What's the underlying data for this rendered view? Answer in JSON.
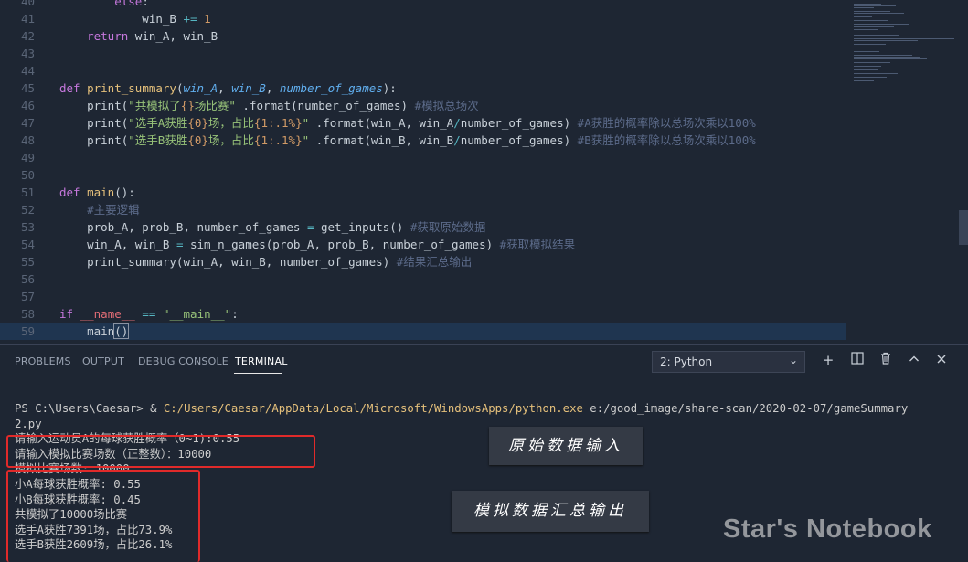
{
  "editor": {
    "lines": [
      {
        "n": "40",
        "segs": [
          {
            "t": "        ",
            "c": ""
          },
          {
            "t": "else",
            "c": "kw"
          },
          {
            "t": ":",
            "c": ""
          }
        ]
      },
      {
        "n": "41",
        "segs": [
          {
            "t": "            win_B ",
            "c": ""
          },
          {
            "t": "+=",
            "c": "op"
          },
          {
            "t": " ",
            "c": ""
          },
          {
            "t": "1",
            "c": "num"
          }
        ]
      },
      {
        "n": "42",
        "segs": [
          {
            "t": "    ",
            "c": ""
          },
          {
            "t": "return",
            "c": "kw"
          },
          {
            "t": " win_A, win_B",
            "c": ""
          }
        ]
      },
      {
        "n": "43",
        "segs": []
      },
      {
        "n": "44",
        "segs": []
      },
      {
        "n": "45",
        "segs": [
          {
            "t": "def",
            "c": "kw"
          },
          {
            "t": " ",
            "c": ""
          },
          {
            "t": "print_summary",
            "c": "fn"
          },
          {
            "t": "(",
            "c": ""
          },
          {
            "t": "win_A",
            "c": "pm"
          },
          {
            "t": ", ",
            "c": ""
          },
          {
            "t": "win_B",
            "c": "pm"
          },
          {
            "t": ", ",
            "c": ""
          },
          {
            "t": "number_of_games",
            "c": "pm"
          },
          {
            "t": "):",
            "c": ""
          }
        ]
      },
      {
        "n": "46",
        "segs": [
          {
            "t": "    print(",
            "c": ""
          },
          {
            "t": "\"共模拟了",
            "c": "st"
          },
          {
            "t": "{}",
            "c": "brace"
          },
          {
            "t": "场比赛\"",
            "c": "st"
          },
          {
            "t": " .format(number_of_games)",
            "c": ""
          },
          {
            "t": " #模拟总场次",
            "c": "cm"
          }
        ]
      },
      {
        "n": "47",
        "segs": [
          {
            "t": "    print(",
            "c": ""
          },
          {
            "t": "\"选手A获胜",
            "c": "st"
          },
          {
            "t": "{0}",
            "c": "brace"
          },
          {
            "t": "场，占比",
            "c": "st"
          },
          {
            "t": "{1:.1%}",
            "c": "brace"
          },
          {
            "t": "\"",
            "c": "st"
          },
          {
            "t": " .format(win_A, win_A",
            "c": ""
          },
          {
            "t": "/",
            "c": "op"
          },
          {
            "t": "number_of_games)",
            "c": ""
          },
          {
            "t": " #A获胜的概率除以总场次乘以100%",
            "c": "cm"
          }
        ]
      },
      {
        "n": "48",
        "segs": [
          {
            "t": "    print(",
            "c": ""
          },
          {
            "t": "\"选手B获胜",
            "c": "st"
          },
          {
            "t": "{0}",
            "c": "brace"
          },
          {
            "t": "场，占比",
            "c": "st"
          },
          {
            "t": "{1:.1%}",
            "c": "brace"
          },
          {
            "t": "\"",
            "c": "st"
          },
          {
            "t": " .format(win_B, win_B",
            "c": ""
          },
          {
            "t": "/",
            "c": "op"
          },
          {
            "t": "number_of_games)",
            "c": ""
          },
          {
            "t": " #B获胜的概率除以总场次乘以100%",
            "c": "cm"
          }
        ]
      },
      {
        "n": "49",
        "segs": []
      },
      {
        "n": "50",
        "segs": []
      },
      {
        "n": "51",
        "segs": [
          {
            "t": "def",
            "c": "kw"
          },
          {
            "t": " ",
            "c": ""
          },
          {
            "t": "main",
            "c": "fn"
          },
          {
            "t": "():",
            "c": ""
          }
        ]
      },
      {
        "n": "52",
        "segs": [
          {
            "t": "    ",
            "c": ""
          },
          {
            "t": "#主要逻辑",
            "c": "cm"
          }
        ]
      },
      {
        "n": "53",
        "segs": [
          {
            "t": "    prob_A, prob_B, number_of_games ",
            "c": ""
          },
          {
            "t": "=",
            "c": "op"
          },
          {
            "t": " get_inputs()",
            "c": ""
          },
          {
            "t": " #获取原始数据",
            "c": "cm"
          }
        ]
      },
      {
        "n": "54",
        "segs": [
          {
            "t": "    win_A, win_B ",
            "c": ""
          },
          {
            "t": "=",
            "c": "op"
          },
          {
            "t": " sim_n_games(prob_A, prob_B, number_of_games)",
            "c": ""
          },
          {
            "t": " #获取模拟结果",
            "c": "cm"
          }
        ]
      },
      {
        "n": "55",
        "segs": [
          {
            "t": "    print_summary(win_A, win_B, number_of_games)",
            "c": ""
          },
          {
            "t": " #结果汇总输出",
            "c": "cm"
          }
        ]
      },
      {
        "n": "56",
        "segs": []
      },
      {
        "n": "57",
        "segs": []
      },
      {
        "n": "58",
        "segs": [
          {
            "t": "if",
            "c": "kw"
          },
          {
            "t": " ",
            "c": ""
          },
          {
            "t": "__name__",
            "c": "dunder"
          },
          {
            "t": " ",
            "c": ""
          },
          {
            "t": "==",
            "c": "op"
          },
          {
            "t": " ",
            "c": ""
          },
          {
            "t": "\"__main__\"",
            "c": "st"
          },
          {
            "t": ":",
            "c": ""
          }
        ]
      },
      {
        "n": "59",
        "segs": [
          {
            "t": "    main",
            "c": ""
          },
          {
            "t": "()",
            "c": "cursor-box"
          }
        ]
      }
    ],
    "current_line": "59"
  },
  "panel": {
    "tabs": [
      "PROBLEMS",
      "OUTPUT",
      "DEBUG CONSOLE",
      "TERMINAL"
    ],
    "active_tab": "TERMINAL",
    "terminal_select": "2: Python",
    "icons": [
      "plus-icon",
      "split-icon",
      "trash-icon",
      "chevron-up-icon",
      "close-icon"
    ]
  },
  "terminal": {
    "prompt_prefix": "PS C:\\Users\\Caesar> & ",
    "prompt_path": "C:/Users/Caesar/AppData/Local/Microsoft/WindowsApps/python.exe",
    "prompt_arg": " e:/good_image/share-scan/2020-02-07/gameSummary",
    "prompt_wrap": "2.py",
    "input_lines": [
      "请输入运动员A的每球获胜概率（0~1):0.55",
      "请输入模拟比赛场数（正整数）：10000"
    ],
    "output_lines": [
      "模拟比赛场数: 10000",
      "小A每球获胜概率: 0.55",
      "小B每球获胜概率: 0.45",
      "共模拟了10000场比赛",
      "选手A获胜7391场，占比73.9%",
      "选手B获胜2609场，占比26.1%"
    ]
  },
  "annotations": {
    "input_label": "原始数据输入",
    "output_label": "模拟数据汇总输出"
  },
  "watermark": "Star's Notebook"
}
